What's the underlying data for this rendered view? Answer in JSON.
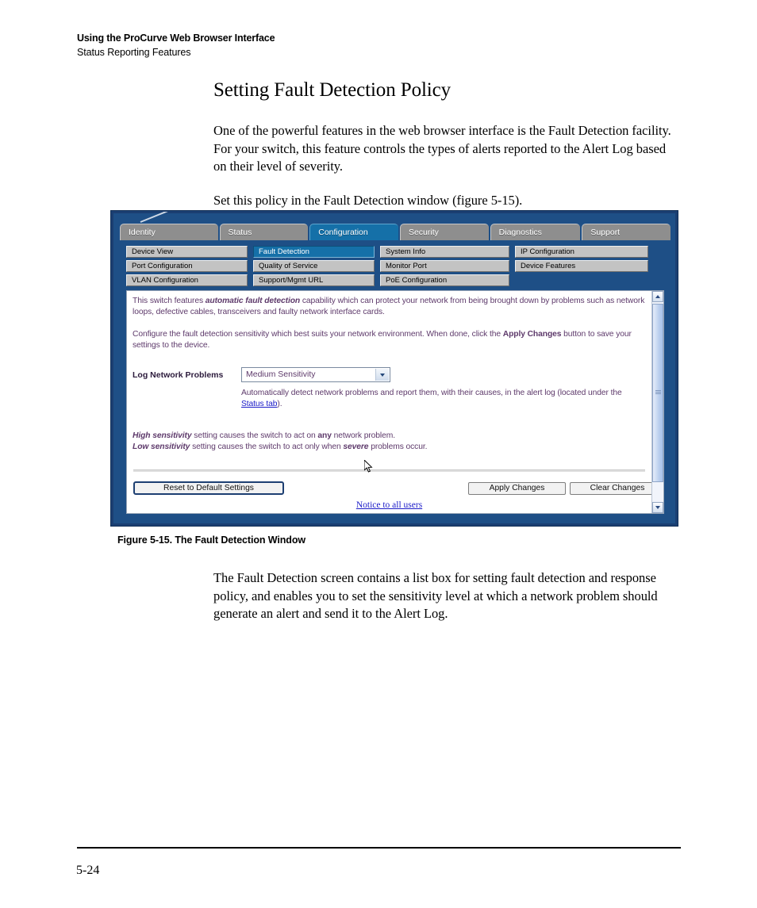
{
  "page": {
    "running_head_title": "Using the ProCurve Web Browser Interface",
    "running_head_subtitle": "Status Reporting Features",
    "page_number": "5-24"
  },
  "section": {
    "title": "Setting Fault Detection Policy",
    "paragraph_1": "One of the powerful features in the web browser interface is the Fault Detection facility. For your switch, this feature controls the types of alerts reported to the Alert Log based on their level of severity.",
    "paragraph_2": "Set this policy in the Fault Detection window (figure 5-15)."
  },
  "figure": {
    "caption": "Figure 5-15. The Fault Detection Window",
    "following_paragraph": "The Fault Detection screen contains a list box for setting fault detection and response policy, and enables you to set the sensitivity level at which a network problem should generate an alert and send it to the Alert Log."
  },
  "screenshot": {
    "tabs": [
      {
        "label": "Identity",
        "selected": false
      },
      {
        "label": "Status",
        "selected": false
      },
      {
        "label": "Configuration",
        "selected": true
      },
      {
        "label": "Security",
        "selected": false
      },
      {
        "label": "Diagnostics",
        "selected": false
      },
      {
        "label": "Support",
        "selected": false
      }
    ],
    "submenu": [
      {
        "label": "Device View",
        "selected": false
      },
      {
        "label": "Fault Detection",
        "selected": true
      },
      {
        "label": "System Info",
        "selected": false
      },
      {
        "label": "IP Configuration",
        "selected": false
      },
      {
        "label": "Port Configuration",
        "selected": false
      },
      {
        "label": "Quality of Service",
        "selected": false
      },
      {
        "label": "Monitor Port",
        "selected": false
      },
      {
        "label": "Device Features",
        "selected": false
      },
      {
        "label": "VLAN Configuration",
        "selected": false
      },
      {
        "label": "Support/Mgmt URL",
        "selected": false
      },
      {
        "label": "PoE Configuration",
        "selected": false
      }
    ],
    "pane": {
      "intro_before_bold": "This switch features ",
      "intro_bold": "automatic fault detection",
      "intro_after_bold": " capability which can protect your network from being brought down by problems such as network loops, defective cables, transceivers and faulty network interface cards.",
      "configure_before_bold": "Configure the fault detection sensitivity which best suits your network environment. When done, click the ",
      "configure_bold": "Apply Changes",
      "configure_after_bold": " button to save your settings to the device.",
      "log_label": "Log Network Problems",
      "sensitivity_value": "Medium Sensitivity",
      "auto_text_before_link": "Automatically detect network problems and report them, with their causes, in the alert log (located under the ",
      "auto_link_text": "Status tab",
      "auto_text_after_link": ").",
      "high_bold": "High sensitivity",
      "high_rest_1": " setting causes the switch to act on ",
      "high_bold_2": "any",
      "high_rest_2": " network problem.",
      "low_bold": "Low sensitivity",
      "low_rest_1": " setting causes the switch to act only when ",
      "low_bold_2": "severe",
      "low_rest_2": " problems occur.",
      "btn_reset": "Reset to Default Settings",
      "btn_apply": "Apply Changes",
      "btn_clear": "Clear Changes",
      "notice_link": "Notice to all users"
    },
    "colors": {
      "frame_navy": "#1b3f72",
      "tab_active_blue": "#1570a8",
      "tab_inactive_gray": "#8e8e8e",
      "pane_text_purple": "#5e3a6b",
      "link_blue": "#1b1bc8"
    }
  }
}
